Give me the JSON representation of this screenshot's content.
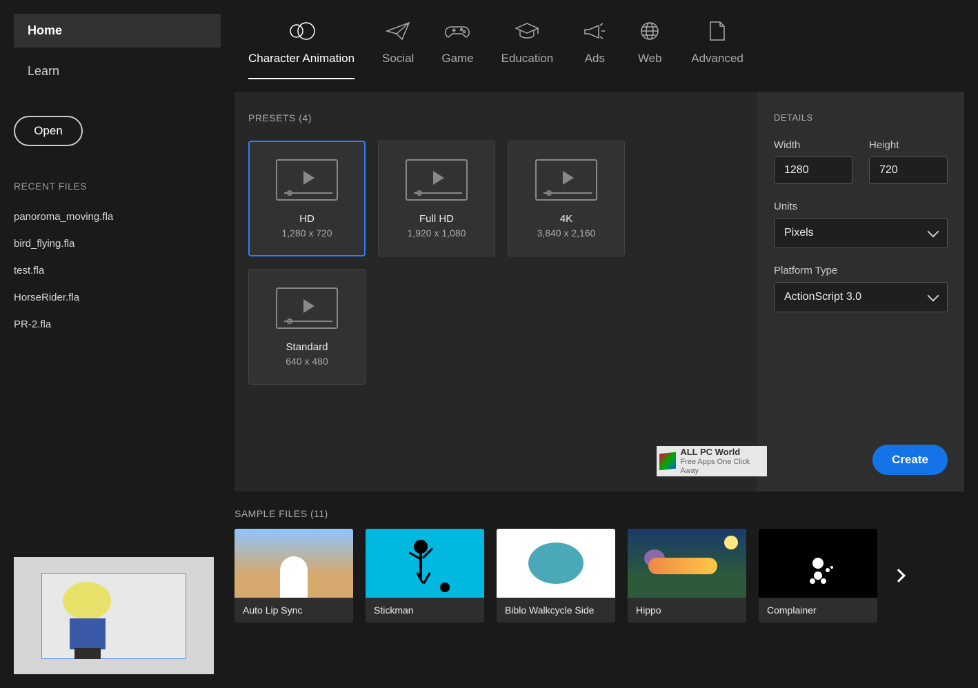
{
  "sidebar": {
    "nav": [
      {
        "label": "Home",
        "active": true
      },
      {
        "label": "Learn",
        "active": false
      }
    ],
    "open_label": "Open",
    "recent_header": "RECENT FILES",
    "recent": [
      "panoroma_moving.fla",
      "bird_flying.fla",
      "test.fla",
      "HorseRider.fla",
      "PR-2.fla"
    ]
  },
  "tabs": [
    {
      "label": "Character Animation",
      "active": true,
      "icon": "character"
    },
    {
      "label": "Social",
      "active": false,
      "icon": "paper-plane"
    },
    {
      "label": "Game",
      "active": false,
      "icon": "gamepad"
    },
    {
      "label": "Education",
      "active": false,
      "icon": "graduation"
    },
    {
      "label": "Ads",
      "active": false,
      "icon": "megaphone"
    },
    {
      "label": "Web",
      "active": false,
      "icon": "globe"
    },
    {
      "label": "Advanced",
      "active": false,
      "icon": "document"
    }
  ],
  "presets": {
    "header": "PRESETS (4)",
    "items": [
      {
        "name": "HD",
        "size": "1,280 x 720",
        "selected": true
      },
      {
        "name": "Full HD",
        "size": "1,920 x 1,080",
        "selected": false
      },
      {
        "name": "4K",
        "size": "3,840 x 2,160",
        "selected": false
      },
      {
        "name": "Standard",
        "size": "640 x 480",
        "selected": false
      }
    ]
  },
  "details": {
    "header": "DETAILS",
    "width_label": "Width",
    "width_value": "1280",
    "height_label": "Height",
    "height_value": "720",
    "units_label": "Units",
    "units_value": "Pixels",
    "platform_label": "Platform Type",
    "platform_value": "ActionScript 3.0",
    "create_label": "Create"
  },
  "watermark": {
    "title": "ALL PC World",
    "subtitle": "Free Apps One Click Away"
  },
  "samples": {
    "header": "SAMPLE FILES (11)",
    "items": [
      {
        "label": "Auto Lip Sync",
        "thumb": "autolip"
      },
      {
        "label": "Stickman",
        "thumb": "stickman"
      },
      {
        "label": "Biblo Walkcycle Side",
        "thumb": "biblo"
      },
      {
        "label": "Hippo",
        "thumb": "hippo"
      },
      {
        "label": "Complainer",
        "thumb": "complainer"
      }
    ]
  }
}
